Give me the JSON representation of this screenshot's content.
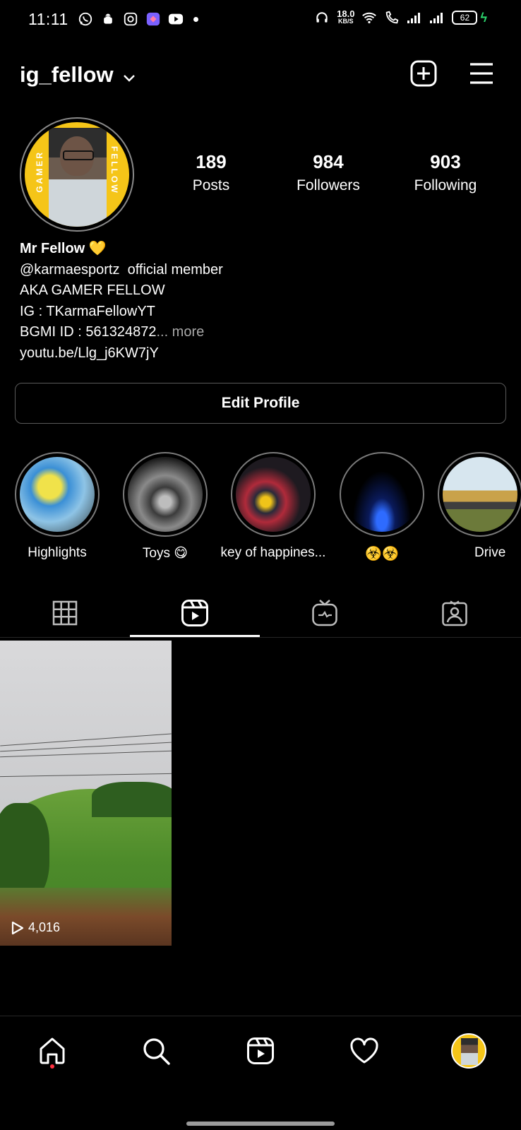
{
  "status_bar": {
    "time": "11:11",
    "net_speed_value": "18.0",
    "net_speed_unit": "KB/S",
    "battery": "62"
  },
  "header": {
    "username": "ig_fellow"
  },
  "avatar": {
    "left_text": "GAMER",
    "right_text": "FELLOW"
  },
  "stats": [
    {
      "value": "189",
      "label": "Posts"
    },
    {
      "value": "984",
      "label": "Followers"
    },
    {
      "value": "903",
      "label": "Following"
    }
  ],
  "bio": {
    "name": "Mr Fellow",
    "heart": "💛",
    "line1_mention": "@karmaesportz",
    "line1_rest": "official member",
    "line2": "AKA GAMER FELLOW",
    "line3": "IG : TKarmaFellowYT",
    "line4": "BGMI ID : 561324872",
    "more": "... more",
    "link": "youtu.be/Llg_j6KW7jY"
  },
  "edit_profile_label": "Edit Profile",
  "highlights": [
    {
      "label": "Highlights"
    },
    {
      "label": "Toys 😋"
    },
    {
      "label": "key of happines..."
    },
    {
      "label": "☣️☣️"
    },
    {
      "label": "Drive"
    }
  ],
  "tabs": {
    "active": "reels",
    "items": [
      "grid",
      "reels",
      "igtv",
      "tagged"
    ]
  },
  "reels": [
    {
      "views": "4,016"
    }
  ],
  "nav": {
    "items": [
      "home",
      "search",
      "reels",
      "activity",
      "profile"
    ],
    "notification_dot_color": "#ff3040"
  },
  "colors": {
    "background": "#000000",
    "text": "#ffffff",
    "muted": "#a8a8a8",
    "brand_yellow": "#f5c518"
  }
}
